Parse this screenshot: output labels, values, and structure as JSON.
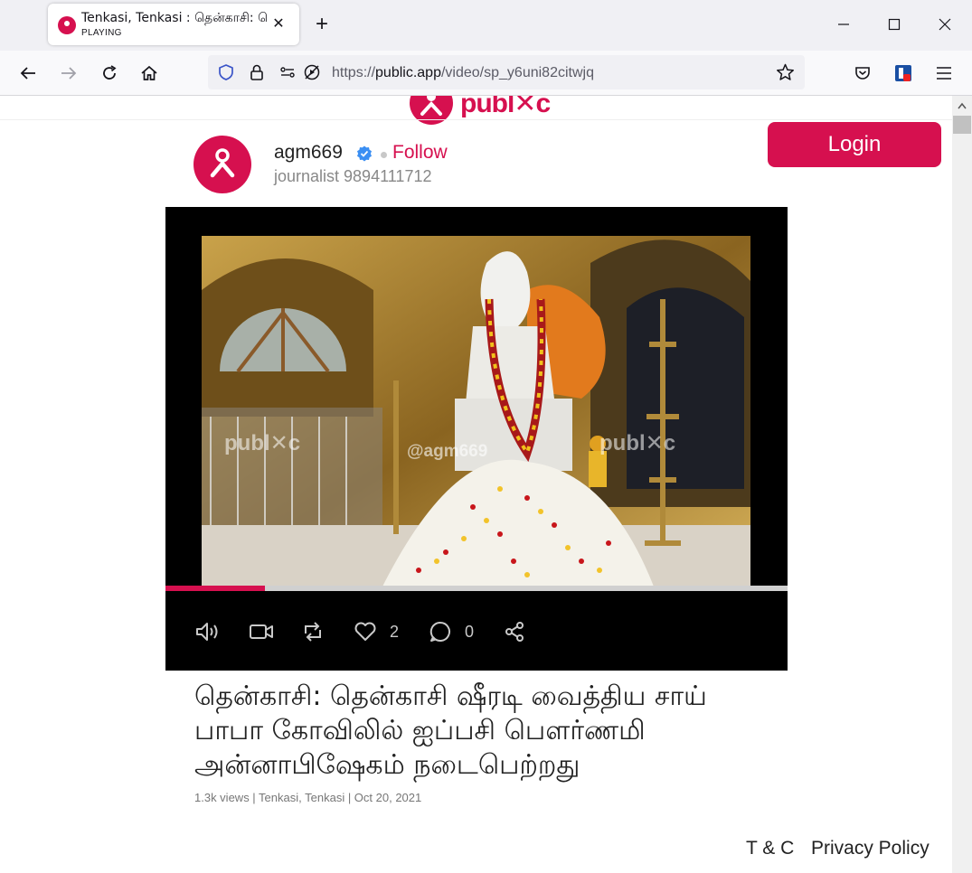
{
  "browser": {
    "tab": {
      "title": "Tenkasi, Tenkasi : தென்காசி: தென்காசி ஷீரடி",
      "subtitle": "PLAYING",
      "close": "✕"
    },
    "new_tab": "+",
    "url": {
      "scheme": "https://",
      "host": "public.app",
      "path": "/video/sp_y6uni82citwjq"
    }
  },
  "page": {
    "logo_text": "publ✕c",
    "login_label": "Login",
    "author": {
      "name": "agm669",
      "follow_label": "Follow",
      "subtitle": "journalist 9894111712"
    },
    "video": {
      "watermark_brand": "publ✕c",
      "watermark_user": "@agm669",
      "progress": 0.16,
      "likes": "2",
      "comments": "0"
    },
    "headline": "தென்காசி: தென்காசி ஷீரடி வைத்திய சாய் பாபா கோவிலில் ஐப்பசி பௌர்ணமி அன்னாபிஷேகம் நடைபெற்றது",
    "meta": "1.3k views | Tenkasi, Tenkasi | Oct 20, 2021",
    "footer": {
      "terms": "T & C",
      "privacy": "Privacy Policy"
    }
  },
  "colors": {
    "brand": "#d6104f",
    "verified": "#3b8ff3"
  }
}
